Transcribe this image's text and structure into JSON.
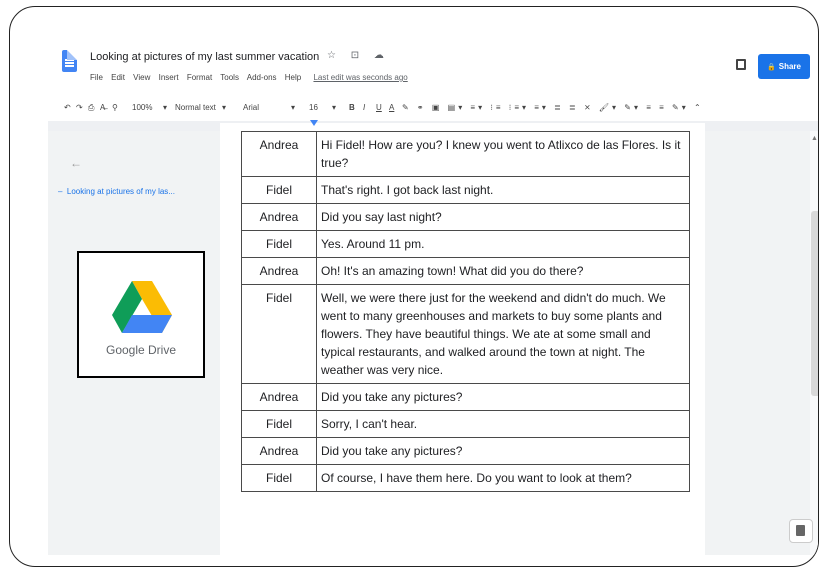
{
  "document": {
    "title": "Looking at pictures of my last summer vacation",
    "title_icons": "☆ ⊡ ☁",
    "menu": [
      "File",
      "Edit",
      "View",
      "Insert",
      "Format",
      "Tools",
      "Add-ons",
      "Help"
    ],
    "last_edit": "Last edit was seconds ago"
  },
  "header": {
    "share_label": "Share",
    "share_icon": "🔒"
  },
  "toolbar": {
    "undo": "↶",
    "redo": "↷",
    "print": "⎙",
    "spell": "A̶",
    "paint": "⚲",
    "zoom": "100%",
    "style": "Normal text",
    "font": "Arial",
    "size": "16",
    "bold": "B",
    "italic": "I",
    "underline": "U",
    "color": "A",
    "extras": "✎ ⚭ ▣ ▤▾ ≡▾ ⁝≡ ⁝≡▾ ≡▾ ≣ ≣ ⨯ 🖌▾ ✎▾ ≡ ≡ ✎▾ ⌃"
  },
  "sidebar": {
    "back_icon": "←",
    "outline_item": "Looking at pictures of my las...",
    "logo_text": "Google Drive"
  },
  "dialogue": [
    {
      "speaker": "Andrea",
      "line": "Hi Fidel! How are you? I knew you went to Atlixco de las Flores. Is it true?"
    },
    {
      "speaker": "Fidel",
      "line": "That's right. I got back last night."
    },
    {
      "speaker": "Andrea",
      "line": "Did you say last night?"
    },
    {
      "speaker": "Fidel",
      "line": "Yes. Around 11 pm."
    },
    {
      "speaker": "Andrea",
      "line": "Oh! It's an amazing town! What did you do there?"
    },
    {
      "speaker": "Fidel",
      "line": "Well, we were there just for the weekend and didn't do much. We went to many greenhouses and markets to buy some plants and flowers. They have beautiful things. We ate at some small and typical restaurants, and walked around the town at night. The weather was very nice."
    },
    {
      "speaker": "Andrea",
      "line": "Did you take any pictures?"
    },
    {
      "speaker": "Fidel",
      "line": "Sorry, I can't hear."
    },
    {
      "speaker": "Andrea",
      "line": "Did you take any pictures?"
    },
    {
      "speaker": "Fidel",
      "line": "Of course, I have them here. Do you want to look at them?"
    }
  ],
  "colors": {
    "accent": "#1a73e8",
    "panel": "#f1f3f4",
    "border": "#4a4a4a"
  }
}
